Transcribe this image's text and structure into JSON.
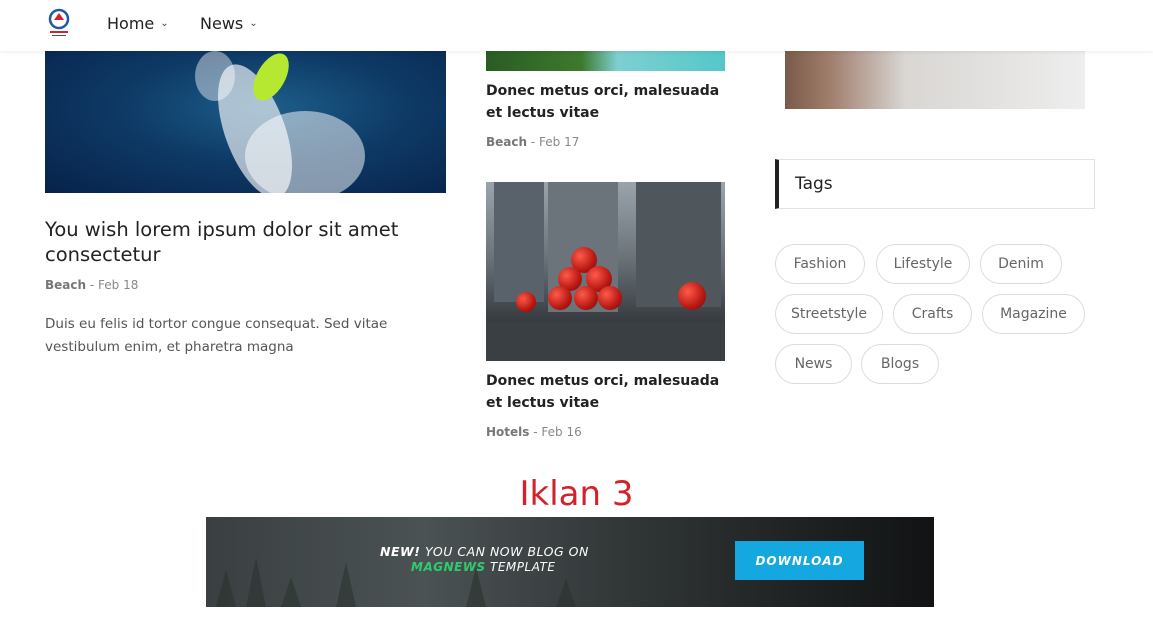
{
  "header": {
    "nav": [
      {
        "label": "Home"
      },
      {
        "label": "News"
      }
    ]
  },
  "posts": {
    "featured": {
      "title": "You wish lorem ipsum dolor sit amet consectetur",
      "category": "Beach",
      "date": "Feb 18",
      "excerpt": "Duis eu felis id tortor congue consequat. Sed vitae vestibulum enim, et pharetra magna"
    },
    "middle": [
      {
        "title": "Donec metus orci, malesuada et lectus vitae",
        "category": "Beach",
        "date": "Feb 17"
      },
      {
        "title": "Donec metus orci, malesuada et lectus vitae",
        "category": "Hotels",
        "date": "Feb 16"
      }
    ]
  },
  "sidebar": {
    "tags_title": "Tags",
    "tags": [
      "Fashion",
      "Lifestyle",
      "Denim",
      "Streetstyle",
      "Crafts",
      "Magazine",
      "News",
      "Blogs"
    ]
  },
  "ad": {
    "label": "Iklan 3",
    "line1_bold": "NEW!",
    "line1_rest": " YOU CAN NOW BLOG ON",
    "line2_brand": "MAGNEWS",
    "line2_rest": " TEMPLATE",
    "button": "DOWNLOAD"
  },
  "colors": {
    "ad_label": "#d2232a",
    "ad_button": "#14a7e0",
    "brand_green": "#2ecc71"
  },
  "icons": {
    "logo": "site-logo-icon",
    "dropdown": "chevron-down-icon"
  }
}
